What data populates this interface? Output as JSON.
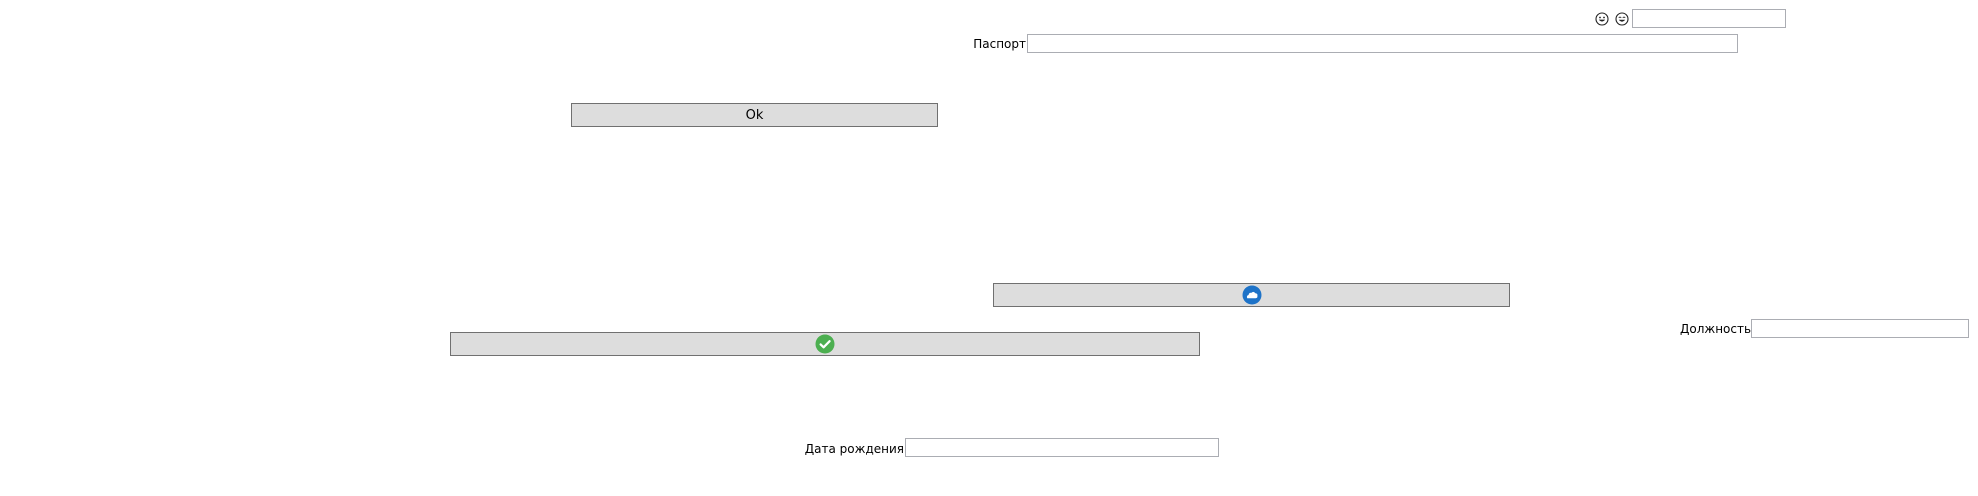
{
  "top_icons": [
    {
      "name": "smiley-grin-icon"
    },
    {
      "name": "smiley-laugh-icon"
    }
  ],
  "top_field": {
    "value": "",
    "placeholder": ""
  },
  "passport": {
    "label": "Паспорт",
    "value": ""
  },
  "ok_button": {
    "label": "Ok"
  },
  "cloud_button": {
    "icon": "cloud-icon",
    "icon_color": "#1e73c8"
  },
  "check_button": {
    "icon": "checkmark-icon",
    "icon_color": "#4caf50"
  },
  "position": {
    "label": "Должность",
    "value": ""
  },
  "birth_date": {
    "label": "Дата рождения",
    "value": ""
  }
}
